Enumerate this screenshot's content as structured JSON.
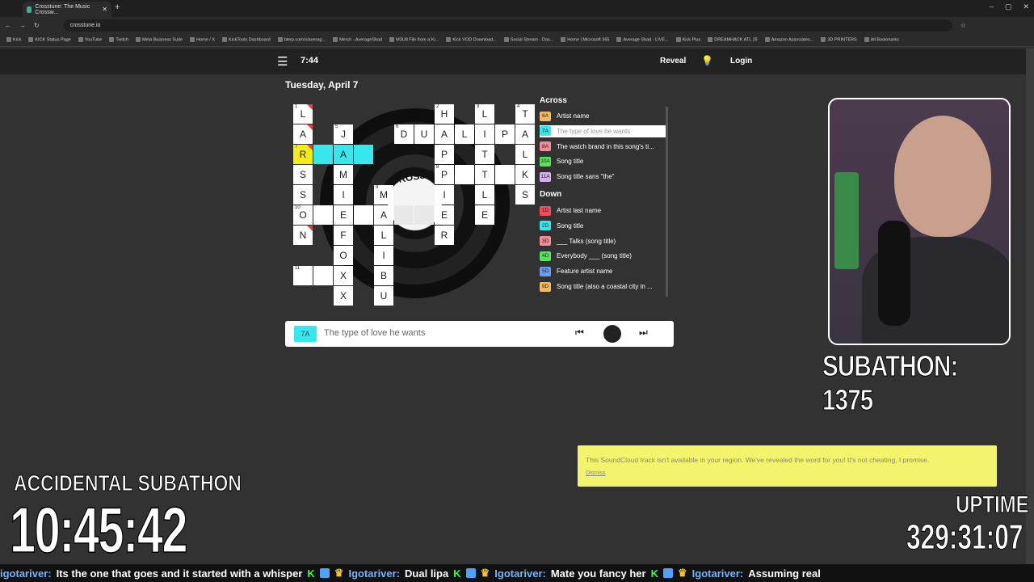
{
  "browser": {
    "tab_title": "Crosstune: The Music Crossw...",
    "url": "crosstune.io",
    "bookmarks": [
      "Kick",
      "KICK Status Page",
      "YouTube",
      "Twitch",
      "Meta Business Suite",
      "Home / X",
      "KickTools Dashboard",
      "blerp.com/x/averag...",
      "Merch - AverageShad",
      "M3U8 File from a Ki...",
      "Kick VOD Download...",
      "Social Stream - Das...",
      "Home | Microsoft 365",
      "Average Shad - LIVE...",
      "Kick Plus",
      "DREAMHACK ATL 25",
      "Amazon Associates...",
      "3D PRINTERS",
      "All Bookmarks"
    ]
  },
  "header": {
    "menu_icon": "☰",
    "clock": "7:44",
    "reveal": "Reveal",
    "bulb_icon": "💡",
    "login": "Login"
  },
  "date": "Tuesday, April 7",
  "record_label": "CROSSTUNE",
  "grid": [
    {
      "c": "L",
      "n": "1",
      "col": 0,
      "row": 0,
      "red": true
    },
    {
      "c": "A",
      "col": 0,
      "row": 1,
      "red": true
    },
    {
      "c": "R",
      "n": "7",
      "col": 0,
      "row": 2,
      "style": "yl",
      "red": true
    },
    {
      "c": "S",
      "col": 0,
      "row": 3
    },
    {
      "c": "S",
      "col": 0,
      "row": 4
    },
    {
      "c": "O",
      "n": "10",
      "col": 0,
      "row": 5
    },
    {
      "c": "N",
      "col": 0,
      "row": 6,
      "red": true
    },
    {
      "c": "",
      "n": "11",
      "col": 0,
      "row": 8
    },
    {
      "c": "",
      "col": 1,
      "row": 2,
      "style": "cy"
    },
    {
      "c": "",
      "col": 1,
      "row": 5
    },
    {
      "c": "",
      "col": 1,
      "row": 8
    },
    {
      "c": "J",
      "n": "5",
      "col": 2,
      "row": 1
    },
    {
      "c": "A",
      "col": 2,
      "row": 2,
      "style": "cy"
    },
    {
      "c": "M",
      "col": 2,
      "row": 3
    },
    {
      "c": "I",
      "col": 2,
      "row": 4
    },
    {
      "c": "E",
      "col": 2,
      "row": 5
    },
    {
      "c": "F",
      "col": 2,
      "row": 6
    },
    {
      "c": "O",
      "col": 2,
      "row": 7
    },
    {
      "c": "X",
      "col": 2,
      "row": 8
    },
    {
      "c": "X",
      "col": 2,
      "row": 9
    },
    {
      "c": "",
      "col": 3,
      "row": 2,
      "style": "cy"
    },
    {
      "c": "",
      "col": 3,
      "row": 5
    },
    {
      "c": "M",
      "n": "9",
      "col": 4,
      "row": 4
    },
    {
      "c": "A",
      "col": 4,
      "row": 5
    },
    {
      "c": "L",
      "col": 4,
      "row": 6
    },
    {
      "c": "I",
      "col": 4,
      "row": 7
    },
    {
      "c": "B",
      "col": 4,
      "row": 8
    },
    {
      "c": "U",
      "col": 4,
      "row": 9
    },
    {
      "c": "D",
      "n": "6",
      "col": 5,
      "row": 1
    },
    {
      "c": "",
      "col": 5,
      "row": 5,
      "style": "gr"
    },
    {
      "c": "U",
      "col": 6,
      "row": 1
    },
    {
      "c": "",
      "col": 6,
      "row": 5,
      "style": "gr"
    },
    {
      "c": "H",
      "n": "2",
      "col": 7,
      "row": 0
    },
    {
      "c": "A",
      "col": 7,
      "row": 1
    },
    {
      "c": "P",
      "col": 7,
      "row": 2
    },
    {
      "c": "P",
      "n": "8",
      "col": 7,
      "row": 3
    },
    {
      "c": "I",
      "col": 7,
      "row": 4
    },
    {
      "c": "E",
      "col": 7,
      "row": 5
    },
    {
      "c": "R",
      "col": 7,
      "row": 6
    },
    {
      "c": "L",
      "col": 8,
      "row": 1
    },
    {
      "c": "",
      "col": 8,
      "row": 3
    },
    {
      "c": "L",
      "n": "3",
      "col": 9,
      "row": 0
    },
    {
      "c": "I",
      "col": 9,
      "row": 1
    },
    {
      "c": "T",
      "col": 9,
      "row": 2
    },
    {
      "c": "T",
      "col": 9,
      "row": 3
    },
    {
      "c": "L",
      "col": 9,
      "row": 4
    },
    {
      "c": "E",
      "col": 9,
      "row": 5
    },
    {
      "c": "P",
      "col": 10,
      "row": 1
    },
    {
      "c": "",
      "col": 10,
      "row": 3
    },
    {
      "c": "T",
      "n": "4",
      "col": 11,
      "row": 0
    },
    {
      "c": "A",
      "col": 11,
      "row": 1
    },
    {
      "c": "L",
      "col": 11,
      "row": 2
    },
    {
      "c": "K",
      "col": 11,
      "row": 3
    },
    {
      "c": "S",
      "col": 11,
      "row": 4
    }
  ],
  "across_heading": "Across",
  "across": [
    {
      "num": "6A",
      "text": "Artist name",
      "color": "#f4b860"
    },
    {
      "num": "7A",
      "text": "The type of love he wants",
      "color": "#36e8ec",
      "selected": true
    },
    {
      "num": "8A",
      "text": "The watch brand in this song's ti...",
      "color": "#f08c96"
    },
    {
      "num": "10A",
      "text": "Song title",
      "color": "#5ce05c"
    },
    {
      "num": "11A",
      "text": "Song title sans \"the\"",
      "color": "#d8b0f0"
    }
  ],
  "down_heading": "Down",
  "down": [
    {
      "num": "1D",
      "text": "Artist last name",
      "color": "#f04c5c"
    },
    {
      "num": "2D",
      "text": "Song title",
      "color": "#36e8ec"
    },
    {
      "num": "3D",
      "text": "___ Talks (song title)",
      "color": "#f08c96"
    },
    {
      "num": "4D",
      "text": "Everybody ___ (song title)",
      "color": "#5ce05c"
    },
    {
      "num": "5D",
      "text": "Feature artist name",
      "color": "#6c9cf0"
    },
    {
      "num": "9D",
      "text": "Song title (also a coastal city in ...",
      "color": "#f4b860"
    }
  ],
  "current_clue": {
    "num": "7A",
    "text": "The type of love he wants"
  },
  "player": {
    "prev_icon": "⏮",
    "next_icon": "⏭"
  },
  "toast": {
    "message": "This SoundCloud track isn't available in your region. We've revealed the word for you! It's not cheating, I promise.",
    "dismiss": "Dismiss"
  },
  "overlay": {
    "subathon": "SUBATHON: 1375",
    "accidental_title": "ACCIDENTAL SUBATHON",
    "accidental_timer": "10:45:42",
    "uptime_title": "UPTIME",
    "uptime_value": "329:31:07"
  },
  "ticker": [
    {
      "user": "igotariver:",
      "msg": "Its the one that goes and it started with a whisper"
    },
    {
      "user": "Igotariver:",
      "msg": "Dual lipa"
    },
    {
      "user": "Igotariver:",
      "msg": "Mate you fancy her"
    },
    {
      "user": "Igotariver:",
      "msg": "Assuming real"
    }
  ]
}
